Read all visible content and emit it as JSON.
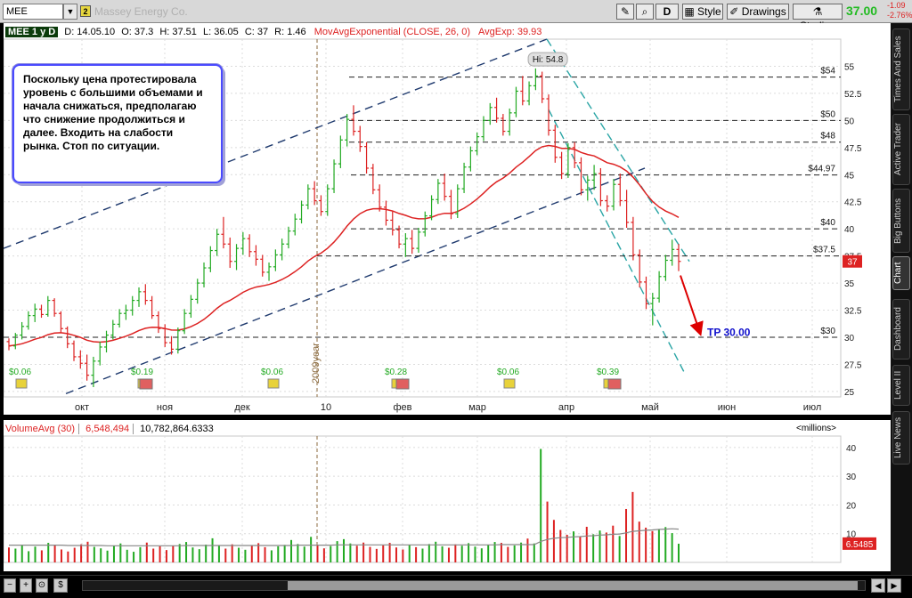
{
  "toolbar": {
    "symbol": "MEE",
    "link_group": "2",
    "company": "Massey Energy Co.",
    "period_button": "D",
    "style_label": "Style",
    "drawings_label": "Drawings",
    "studies_label": "Studies",
    "last_price": "37.00",
    "change_abs": "-1.09",
    "change_pct": "-2.76%"
  },
  "colors": {
    "up_bar": "#22aa22",
    "down_bar": "#dd2222",
    "ema": "#dd2222",
    "channel_dash": "#1f3a6e",
    "teal_channel": "#2aa5a5",
    "arrow": "#dd0000",
    "tp_text": "#1010cc",
    "volume_up": "#22aa22",
    "volume_down": "#dd2222"
  },
  "price_header": {
    "title": "MEE 1 y D",
    "date": "D: 14.05.10",
    "open": "O: 37.3",
    "high": "H: 37.51",
    "low": "L: 36.05",
    "close": "C: 37",
    "range": "R: 1.46",
    "study": "MovAvgExponential (CLOSE, 26, 0)",
    "study_value": "AvgExp: 39.93"
  },
  "callout_text": "Поскольку цена протестировала уровень с большими объемами и начала снижаться, предполагаю что снижение продолжиться и далее. Входить на слабости рынка. Стоп по ситуации.",
  "volume_header": {
    "title": "VolumeAvg (30)",
    "value1": "6,548,494",
    "value2": "10,782,864.6333",
    "units": "<millions>"
  },
  "sidebar_tabs": [
    "Times And Sales",
    "Active Trader",
    "Big Buttons",
    "Chart",
    "Dashboard",
    "Level II",
    "Live News"
  ],
  "chart_data": [
    {
      "type": "candlestick",
      "title": "MEE 1 y D",
      "y_ticks": [
        25,
        27.5,
        30,
        32.5,
        35,
        37.5,
        40,
        42.5,
        45,
        47.5,
        50,
        52.5,
        55
      ],
      "ylim": [
        24.5,
        57.5
      ],
      "x_tick_labels": [
        "окт",
        "ноя",
        "дек",
        "10",
        "фев",
        "мар",
        "апр",
        "май",
        "июн",
        "июл"
      ],
      "year_marker": "2009year",
      "current_price_tag": "37",
      "high_label": "Hi: 54.8",
      "levels": [
        {
          "price": 54,
          "label": "$54"
        },
        {
          "price": 50,
          "label": "$50"
        },
        {
          "price": 48,
          "label": "$48"
        },
        {
          "price": 44.97,
          "label": "$44.97"
        },
        {
          "price": 40,
          "label": "$40"
        },
        {
          "price": 37.5,
          "label": "$37.5"
        },
        {
          "price": 30,
          "label": "$30"
        }
      ],
      "target_label": "TP 30.00",
      "dividends": [
        "$0.06",
        "$0.19",
        "$0.06",
        "$0.28",
        "$0.06",
        "$0.39"
      ],
      "ohlc": [
        [
          29.6,
          29.9,
          28.8,
          29.2
        ],
        [
          29.2,
          30.4,
          28.9,
          30.2
        ],
        [
          30.2,
          31.4,
          29.8,
          31.0
        ],
        [
          31.0,
          32.4,
          30.7,
          32.0
        ],
        [
          32.0,
          33.1,
          31.4,
          32.6
        ],
        [
          32.6,
          33.0,
          31.8,
          32.1
        ],
        [
          32.1,
          33.8,
          31.9,
          33.4
        ],
        [
          33.4,
          33.6,
          31.9,
          32.2
        ],
        [
          32.2,
          32.4,
          30.4,
          30.8
        ],
        [
          30.8,
          31.0,
          29.0,
          29.4
        ],
        [
          29.4,
          29.7,
          27.8,
          28.2
        ],
        [
          28.2,
          28.8,
          27.1,
          27.6
        ],
        [
          27.6,
          28.4,
          26.0,
          26.5
        ],
        [
          26.5,
          28.2,
          25.4,
          27.8
        ],
        [
          27.8,
          29.6,
          27.4,
          29.1
        ],
        [
          29.1,
          30.6,
          28.6,
          30.2
        ],
        [
          30.2,
          31.6,
          29.8,
          31.2
        ],
        [
          31.2,
          32.6,
          30.9,
          32.2
        ],
        [
          32.2,
          33.0,
          31.6,
          32.5
        ],
        [
          32.5,
          33.8,
          32.0,
          33.4
        ],
        [
          33.4,
          34.6,
          32.8,
          34.2
        ],
        [
          34.2,
          34.9,
          33.0,
          33.4
        ],
        [
          33.4,
          33.8,
          31.7,
          32.0
        ],
        [
          32.0,
          32.4,
          30.4,
          30.8
        ],
        [
          30.8,
          31.2,
          29.1,
          29.5
        ],
        [
          29.5,
          30.1,
          28.4,
          28.9
        ],
        [
          28.9,
          30.9,
          28.5,
          30.6
        ],
        [
          30.6,
          32.6,
          30.3,
          32.2
        ],
        [
          32.2,
          33.9,
          31.8,
          33.5
        ],
        [
          33.5,
          35.4,
          33.1,
          35.0
        ],
        [
          35.0,
          36.9,
          34.6,
          36.4
        ],
        [
          36.4,
          38.4,
          36.0,
          38.0
        ],
        [
          38.0,
          40.0,
          37.5,
          39.5
        ],
        [
          39.5,
          41.1,
          38.2,
          38.6
        ],
        [
          38.6,
          39.2,
          36.4,
          37.0
        ],
        [
          37.0,
          38.6,
          36.2,
          38.2
        ],
        [
          38.2,
          39.7,
          37.6,
          39.1
        ],
        [
          39.1,
          39.5,
          37.4,
          37.9
        ],
        [
          37.9,
          38.5,
          36.6,
          37.2
        ],
        [
          37.2,
          37.6,
          35.6,
          36.0
        ],
        [
          36.0,
          36.9,
          35.2,
          36.5
        ],
        [
          36.5,
          38.1,
          36.1,
          37.6
        ],
        [
          37.6,
          39.1,
          37.1,
          38.6
        ],
        [
          38.6,
          40.2,
          38.2,
          39.8
        ],
        [
          39.8,
          41.4,
          39.4,
          40.9
        ],
        [
          40.9,
          42.6,
          40.5,
          42.2
        ],
        [
          42.2,
          44.1,
          41.8,
          43.7
        ],
        [
          43.7,
          44.4,
          42.2,
          42.6
        ],
        [
          42.6,
          43.1,
          41.2,
          41.6
        ],
        [
          41.6,
          44.1,
          41.2,
          43.7
        ],
        [
          43.7,
          46.4,
          43.3,
          46.0
        ],
        [
          46.0,
          48.6,
          45.6,
          48.2
        ],
        [
          48.2,
          50.6,
          47.6,
          50.1
        ],
        [
          50.1,
          51.4,
          48.6,
          49.0
        ],
        [
          49.0,
          49.5,
          47.1,
          47.6
        ],
        [
          47.6,
          48.0,
          45.1,
          45.6
        ],
        [
          45.6,
          46.0,
          43.2,
          43.6
        ],
        [
          43.6,
          44.1,
          41.6,
          42.0
        ],
        [
          42.0,
          42.6,
          40.3,
          40.8
        ],
        [
          40.8,
          41.6,
          39.4,
          39.9
        ],
        [
          39.9,
          40.3,
          38.2,
          38.6
        ],
        [
          38.6,
          39.6,
          37.4,
          39.1
        ],
        [
          39.1,
          39.9,
          37.7,
          38.2
        ],
        [
          38.2,
          40.1,
          37.8,
          39.7
        ],
        [
          39.7,
          41.6,
          39.3,
          41.2
        ],
        [
          41.2,
          43.1,
          40.8,
          42.7
        ],
        [
          42.7,
          44.6,
          42.3,
          44.2
        ],
        [
          44.2,
          45.1,
          42.6,
          43.0
        ],
        [
          43.0,
          43.6,
          40.9,
          41.4
        ],
        [
          41.4,
          44.1,
          41.0,
          43.7
        ],
        [
          43.7,
          46.1,
          43.3,
          45.7
        ],
        [
          45.7,
          47.6,
          45.3,
          47.2
        ],
        [
          47.2,
          48.9,
          46.8,
          48.5
        ],
        [
          48.5,
          50.4,
          48.1,
          50.0
        ],
        [
          50.0,
          51.6,
          49.6,
          51.2
        ],
        [
          51.2,
          52.1,
          49.8,
          50.2
        ],
        [
          50.2,
          50.6,
          48.6,
          49.0
        ],
        [
          49.0,
          51.1,
          48.6,
          50.7
        ],
        [
          50.7,
          53.1,
          50.3,
          52.7
        ],
        [
          52.7,
          54.1,
          51.4,
          51.8
        ],
        [
          51.8,
          53.6,
          51.4,
          53.2
        ],
        [
          53.2,
          54.8,
          52.8,
          54.1
        ],
        [
          54.1,
          54.5,
          51.6,
          52.0
        ],
        [
          52.0,
          52.4,
          48.6,
          49.1
        ],
        [
          49.1,
          49.6,
          46.1,
          46.6
        ],
        [
          46.6,
          47.1,
          44.6,
          45.1
        ],
        [
          45.1,
          47.9,
          44.7,
          47.5
        ],
        [
          47.5,
          48.0,
          45.6,
          46.1
        ],
        [
          46.1,
          46.6,
          43.1,
          43.6
        ],
        [
          43.6,
          44.9,
          42.6,
          44.5
        ],
        [
          44.5,
          45.9,
          43.6,
          45.1
        ],
        [
          45.1,
          45.6,
          42.1,
          42.6
        ],
        [
          42.6,
          43.1,
          41.6,
          42.1
        ],
        [
          42.1,
          44.6,
          41.7,
          44.1
        ],
        [
          44.1,
          45.1,
          42.1,
          42.6
        ],
        [
          42.6,
          43.6,
          40.1,
          40.6
        ],
        [
          40.6,
          41.1,
          37.1,
          37.6
        ],
        [
          37.6,
          38.1,
          34.6,
          35.1
        ],
        [
          35.1,
          35.6,
          32.6,
          33.1
        ],
        [
          33.1,
          34.1,
          31.1,
          33.6
        ],
        [
          33.6,
          36.1,
          33.2,
          35.6
        ],
        [
          35.6,
          37.6,
          35.2,
          37.1
        ],
        [
          37.1,
          39.0,
          36.6,
          38.1
        ],
        [
          38.1,
          38.6,
          36.1,
          37.0
        ]
      ]
    },
    {
      "type": "bar",
      "title": "VolumeAvg (30)",
      "y_ticks": [
        10,
        20,
        30,
        40
      ],
      "ylim": [
        0,
        44
      ],
      "units": "millions",
      "last_value_tag": "6.5485",
      "values": [
        5.2,
        4.8,
        6.1,
        3.9,
        5.5,
        4.2,
        6.8,
        5.9,
        4.5,
        3.8,
        5.1,
        6.3,
        7.2,
        5.4,
        4.9,
        4.1,
        5.8,
        6.6,
        4.4,
        3.7,
        5.3,
        6.9,
        4.8,
        5.6,
        4.3,
        5.9,
        6.4,
        7.1,
        5.2,
        4.6,
        6.2,
        8.4,
        5.9,
        4.8,
        6.3,
        5.1,
        4.4,
        5.8,
        6.7,
        5.3,
        4.2,
        5.6,
        6.1,
        7.8,
        6.4,
        5.5,
        8.9,
        6.2,
        4.9,
        5.7,
        7.4,
        8.1,
        6.6,
        5.8,
        6.9,
        5.4,
        4.7,
        5.9,
        6.8,
        5.2,
        4.5,
        6.1,
        5.3,
        4.8,
        6.4,
        7.2,
        5.6,
        5.1,
        6.3,
        5.8,
        6.7,
        5.5,
        4.9,
        6.2,
        7.1,
        6.8,
        5.4,
        5.9,
        6.9,
        8.3,
        6.6,
        39.5,
        21.2,
        14.8,
        11.3,
        9.6,
        10.8,
        8.9,
        12.4,
        9.8,
        11.1,
        10.4,
        12.8,
        9.2,
        18.6,
        24.5,
        14.2,
        12.1,
        10.9,
        11.6,
        12.3,
        10.2,
        6.5
      ],
      "avg": [
        6.0,
        6.0,
        6.0,
        6.0,
        6.0,
        6.0,
        6.0,
        6.0,
        6.0,
        5.9,
        5.9,
        5.9,
        5.9,
        5.9,
        5.9,
        5.8,
        5.8,
        5.8,
        5.8,
        5.8,
        5.8,
        5.8,
        5.8,
        5.8,
        5.8,
        5.8,
        5.8,
        5.9,
        5.9,
        5.9,
        5.9,
        5.9,
        5.9,
        5.9,
        5.9,
        5.9,
        5.9,
        5.9,
        5.9,
        5.9,
        5.9,
        5.9,
        5.9,
        5.9,
        6.0,
        6.0,
        6.0,
        6.0,
        6.0,
        6.0,
        6.1,
        6.1,
        6.1,
        6.1,
        6.1,
        6.1,
        6.1,
        6.1,
        6.1,
        6.1,
        6.1,
        6.1,
        6.1,
        6.1,
        6.1,
        6.1,
        6.1,
        6.1,
        6.1,
        6.1,
        6.1,
        6.1,
        6.1,
        6.1,
        6.1,
        6.2,
        6.2,
        6.2,
        6.2,
        6.2,
        6.2,
        7.3,
        8.0,
        8.4,
        8.6,
        8.7,
        8.9,
        9.0,
        9.2,
        9.3,
        9.5,
        9.6,
        9.8,
        9.9,
        10.3,
        10.8,
        11.0,
        11.2,
        11.3,
        11.5,
        11.6,
        11.7,
        11.6
      ]
    }
  ]
}
